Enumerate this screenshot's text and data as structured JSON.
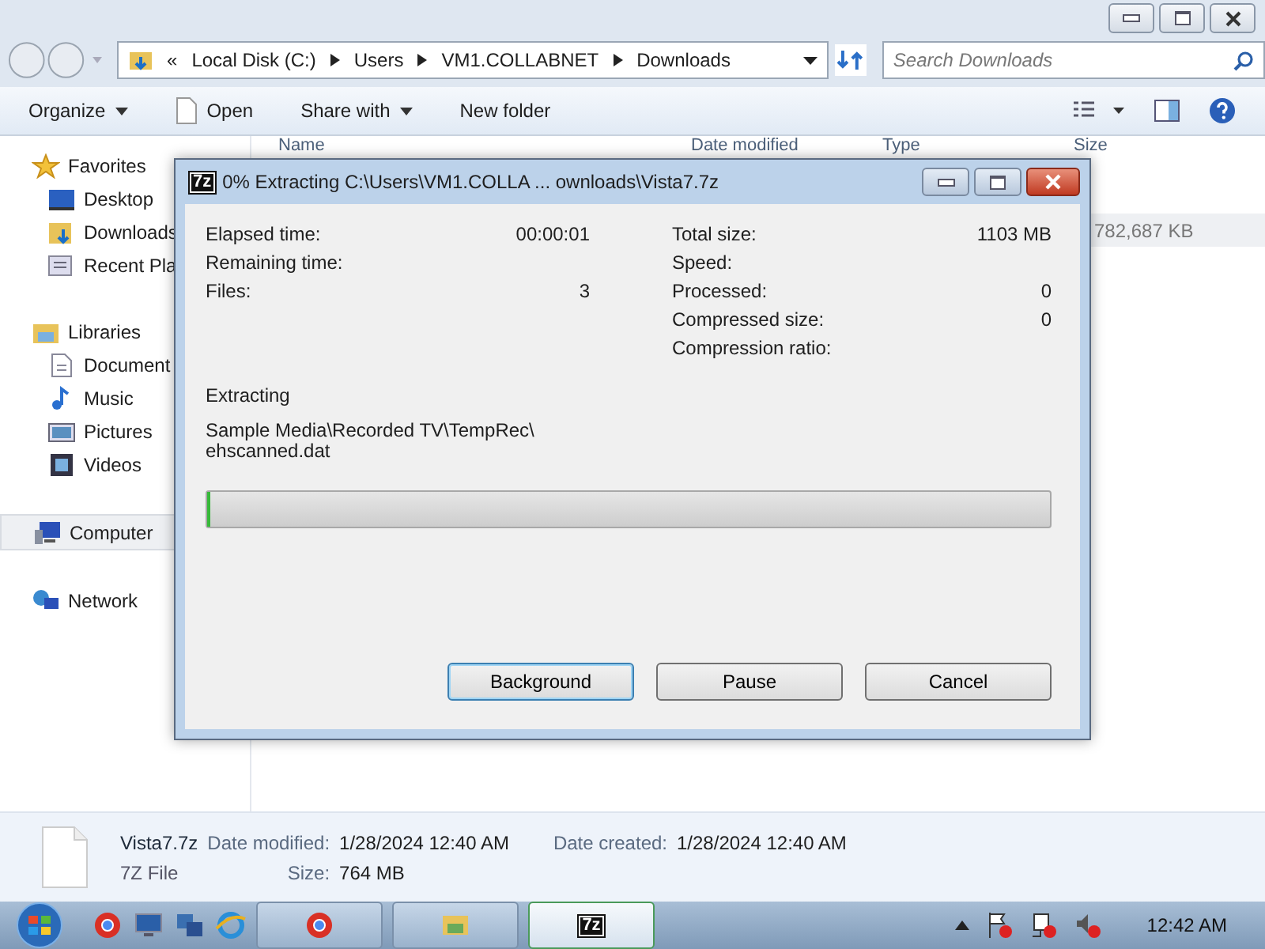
{
  "address": {
    "overflow": "«",
    "crumbs": [
      "Local Disk (C:)",
      "Users",
      "VM1.COLLABNET",
      "Downloads"
    ]
  },
  "search": {
    "placeholder": "Search Downloads"
  },
  "toolbar": [
    {
      "label": "Organize",
      "kind": "menu"
    },
    {
      "label": "Open",
      "kind": "file"
    },
    {
      "label": "Share with",
      "kind": "menu"
    },
    {
      "label": "New folder",
      "kind": "plain"
    }
  ],
  "sidebar": [
    {
      "label": "Favorites",
      "kind": "star",
      "selected": false,
      "children": [
        {
          "label": "Desktop",
          "kind": "desktop",
          "selected": false
        },
        {
          "label": "Downloads",
          "kind": "folder",
          "selected": false
        },
        {
          "label": "Recent Pla",
          "kind": "recent",
          "selected": false
        }
      ]
    },
    {
      "label": "Libraries",
      "kind": "library",
      "selected": false,
      "children": [
        {
          "label": "Document",
          "kind": "document",
          "selected": false
        },
        {
          "label": "Music",
          "kind": "music",
          "selected": false
        },
        {
          "label": "Pictures",
          "kind": "pictures",
          "selected": false
        },
        {
          "label": "Videos",
          "kind": "videos",
          "selected": false
        }
      ]
    },
    {
      "label": "Computer",
      "kind": "computer",
      "selected": true
    },
    {
      "label": "Network",
      "kind": "network",
      "selected": false
    }
  ],
  "columns": [
    "Name",
    "Date modified",
    "Type",
    "Size"
  ],
  "rows": [
    {
      "size": "782,687 KB",
      "selected": true
    }
  ],
  "dialog": {
    "icon_text": "7z",
    "title": "0% Extracting C:\\Users\\VM1.COLLA ... ownloads\\Vista7.7z",
    "stats_left": [
      {
        "label": "Elapsed time:",
        "value": "00:00:01"
      },
      {
        "label": "Remaining time:"
      },
      {
        "label": "Files:",
        "value": "3"
      }
    ],
    "stats_right": [
      {
        "label": "Total size:",
        "value": "1103 MB"
      },
      {
        "label": "Speed:"
      },
      {
        "label": "Processed:",
        "value": "0"
      },
      {
        "label": "Compressed size:",
        "value": "0"
      },
      {
        "label": "Compression ratio:"
      }
    ],
    "status": "Extracting",
    "path": "Sample Media\\Recorded TV\\TempRec\\",
    "file": "ehscanned.dat",
    "progress": {
      "level": 0
    },
    "buttons": [
      {
        "label": "Background",
        "selected": true
      },
      {
        "label": "Pause",
        "selected": false
      },
      {
        "label": "Cancel",
        "selected": false
      }
    ]
  },
  "details": {
    "name": "Vista7.7z",
    "type": "7Z File",
    "modified_label": "Date modified:",
    "modified": "1/28/2024 12:40 AM",
    "created_label": "Date created:",
    "created": "1/28/2024 12:40 AM",
    "size_label": "Size:",
    "size": "764 MB"
  },
  "taskbar": {
    "tasks": [
      {
        "kind": "chrome",
        "selected": false
      },
      {
        "kind": "explorer",
        "selected": false
      },
      {
        "kind": "archiver",
        "text": "7z",
        "selected": true
      }
    ],
    "clock": "12:42 AM"
  }
}
